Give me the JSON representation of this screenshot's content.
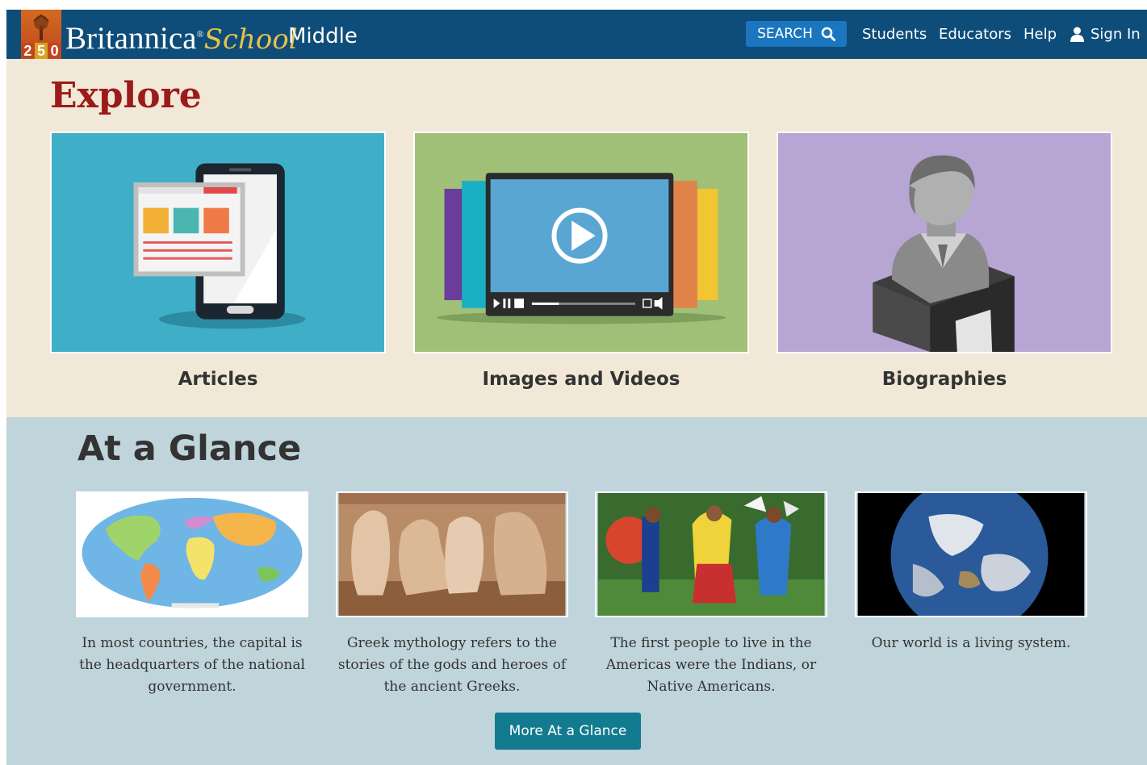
{
  "header": {
    "badge_number": [
      "2",
      "5",
      "0"
    ],
    "brand_name": "Britannica",
    "brand_school": "School",
    "brand_level": "Middle",
    "search_label": "SEARCH",
    "nav": {
      "students": "Students",
      "educators": "Educators",
      "help": "Help",
      "sign_in": "Sign In"
    }
  },
  "explore": {
    "title": "Explore",
    "tiles": [
      {
        "label": "Articles",
        "icon": "phone-document-icon",
        "color": "#3fafc7"
      },
      {
        "label": "Images and Videos",
        "icon": "video-player-icon",
        "color": "#a0c077"
      },
      {
        "label": "Biographies",
        "icon": "bust-statue-icon",
        "color": "#b7a5d3"
      }
    ]
  },
  "glance": {
    "title": "At a Glance",
    "cards": [
      {
        "text": "In most countries, the capital is the headquarters of the national government.",
        "image": "world-map-image"
      },
      {
        "text": "Greek mythology refers to the stories of the gods and heroes of the ancient Greeks.",
        "image": "greek-relief-image"
      },
      {
        "text": "The first people to live in the Americas were the Indians, or Native Americans.",
        "image": "native-dancers-image"
      },
      {
        "text": "Our world is a living system.",
        "image": "earth-globe-image"
      }
    ],
    "more_button": "More At a Glance"
  },
  "colors": {
    "header_bg": "#0e4d7a",
    "explore_bg": "#f1e8d7",
    "glance_bg": "#bfd4db",
    "explore_title": "#9b1b1b",
    "button_teal": "#137b8f"
  }
}
